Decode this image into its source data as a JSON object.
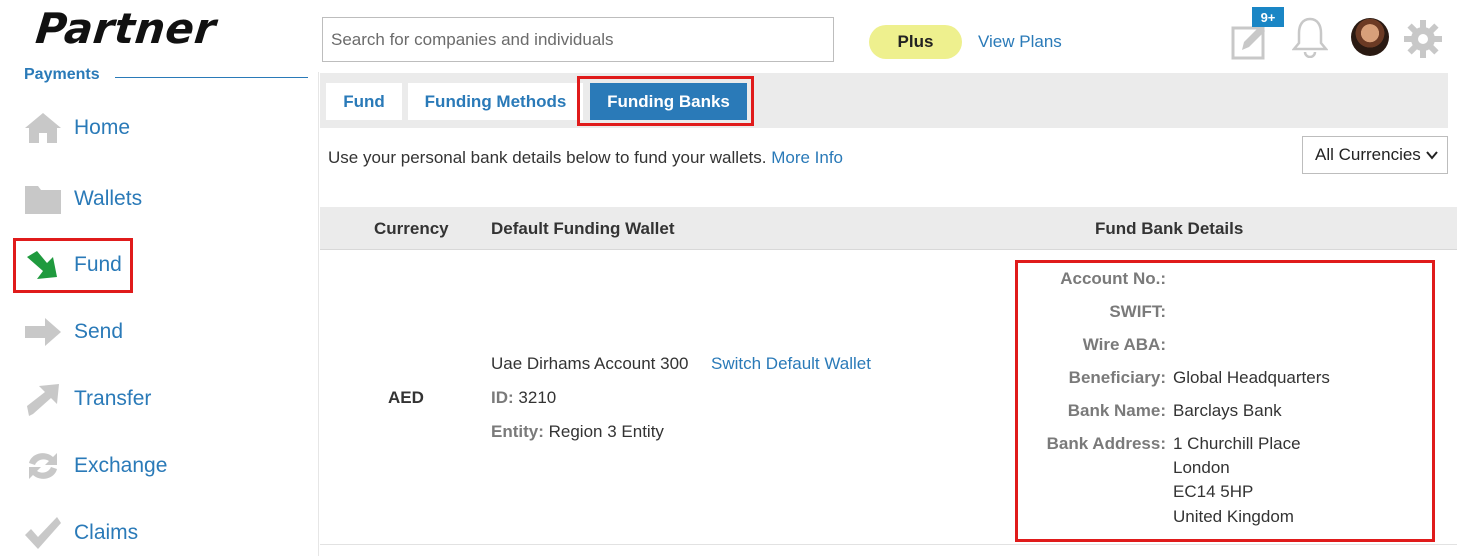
{
  "brand": {
    "logo_text": "Partner"
  },
  "sidebar": {
    "section_title": "Payments",
    "items": [
      {
        "label": "Home",
        "icon": "home-icon"
      },
      {
        "label": "Wallets",
        "icon": "folder-icon"
      },
      {
        "label": "Fund",
        "icon": "fund-arrow-icon"
      },
      {
        "label": "Send",
        "icon": "send-arrow-icon"
      },
      {
        "label": "Transfer",
        "icon": "transfer-arrow-icon"
      },
      {
        "label": "Exchange",
        "icon": "exchange-icon"
      },
      {
        "label": "Claims",
        "icon": "checkmark-icon"
      }
    ]
  },
  "header": {
    "search_placeholder": "Search for companies and individuals",
    "plan_badge": "Plus",
    "view_plans": "View Plans",
    "notification_badge": "9+"
  },
  "tabs": [
    {
      "label": "Fund"
    },
    {
      "label": "Funding Methods"
    },
    {
      "label": "Funding Banks",
      "active": true
    }
  ],
  "intro": {
    "text": "Use your personal bank details below to fund your wallets.",
    "link": "More Info"
  },
  "currency_filter": {
    "selected": "All Currencies"
  },
  "table": {
    "headers": [
      "Currency",
      "Default Funding Wallet",
      "Fund Bank Details"
    ],
    "row": {
      "currency": "AED",
      "wallet_name": "Uae Dirhams Account 300",
      "switch_link": "Switch Default Wallet",
      "id_label": "ID:",
      "id_value": "3210",
      "entity_label": "Entity:",
      "entity_value": "Region 3 Entity",
      "bank_details": {
        "account_no_label": "Account No.:",
        "account_no_value": "",
        "swift_label": "SWIFT:",
        "swift_value": "",
        "wire_aba_label": "Wire ABA:",
        "wire_aba_value": "",
        "beneficiary_label": "Beneficiary:",
        "beneficiary_value": "Global Headquarters",
        "bank_name_label": "Bank Name:",
        "bank_name_value": "Barclays Bank",
        "bank_address_label": "Bank Address:",
        "bank_address_lines": [
          "1 Churchill Place",
          "London",
          "EC14 5HP",
          "United Kingdom"
        ]
      }
    }
  },
  "colors": {
    "accent": "#2a7ab8",
    "fund_icon": "#1f9a3e",
    "highlight": "#e01b1b",
    "plus_pill": "#eef08e"
  }
}
